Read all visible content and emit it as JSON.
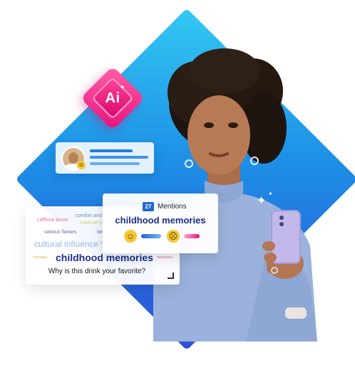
{
  "ai_badge": {
    "label": "Ai"
  },
  "mentions_card": {
    "count": "27",
    "label": "Mentions",
    "topic": "childhood memories",
    "positive_icon": "smile-emoji-icon",
    "negative_icon": "frown-emoji-icon"
  },
  "word_cloud": {
    "words": [
      "caffeine boost",
      "comfort and",
      "habitual ch",
      "various flavors",
      "tas",
      "cultural influence",
      "te",
      "childhood memories",
      "nostalgia",
      "memories"
    ],
    "question": "Why is this drink your favorite?"
  },
  "colors": {
    "diamond_light": "#33c8f2",
    "diamond_dark": "#2f4fd6",
    "badge_pink": "#e8127e",
    "topic_navy": "#1b2e8c",
    "accent_blue": "#1d66d6"
  }
}
